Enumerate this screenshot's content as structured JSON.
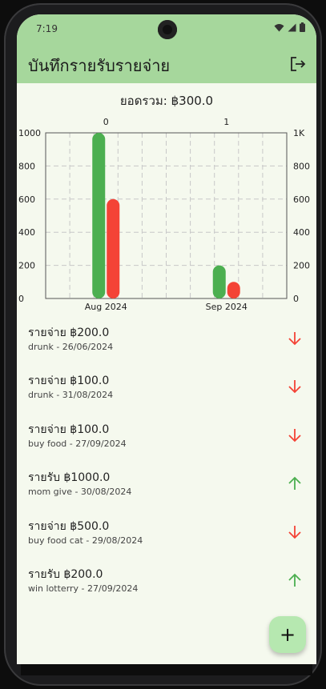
{
  "status_bar": {
    "time": "7:19",
    "icons": [
      "wifi-icon",
      "signal-icon",
      "battery-icon"
    ]
  },
  "app_bar": {
    "title": "บันทึกรายรับรายจ่าย",
    "logout_icon": "logout-icon"
  },
  "total": {
    "text": "ยอดรวม: ฿300.0"
  },
  "chart_data": {
    "type": "bar",
    "categories": [
      "Aug 2024",
      "Sep 2024"
    ],
    "top_labels": [
      "0",
      "1"
    ],
    "series": [
      {
        "values": [
          1000,
          200
        ],
        "color": "#4caf50"
      },
      {
        "values": [
          600,
          100
        ],
        "color": "#f44336"
      }
    ],
    "ylim": [
      0,
      1000
    ],
    "left_ticks": [
      "0",
      "200",
      "400",
      "600",
      "800",
      "1000"
    ],
    "right_ticks": [
      "0",
      "200",
      "400",
      "600",
      "800",
      "1K"
    ],
    "grid": true
  },
  "transactions": [
    {
      "amount": "รายจ่าย ฿200.0",
      "detail": "drunk - 26/06/2024",
      "kind": "expense"
    },
    {
      "amount": "รายจ่าย ฿100.0",
      "detail": "drunk - 31/08/2024",
      "kind": "expense"
    },
    {
      "amount": "รายจ่าย ฿100.0",
      "detail": "buy food - 27/09/2024",
      "kind": "expense"
    },
    {
      "amount": "รายรับ ฿1000.0",
      "detail": "mom give  - 30/08/2024",
      "kind": "income"
    },
    {
      "amount": "รายจ่าย ฿500.0",
      "detail": "buy food cat  - 29/08/2024",
      "kind": "expense"
    },
    {
      "amount": "รายรับ ฿200.0",
      "detail": "win lotterry - 27/09/2024",
      "kind": "income"
    }
  ],
  "colors": {
    "app_bar": "#a6d79c",
    "background": "#f5f9ee",
    "income": "#4caf50",
    "expense": "#f44336",
    "fab": "#b6e8b0"
  },
  "fab": {
    "label": "+"
  }
}
